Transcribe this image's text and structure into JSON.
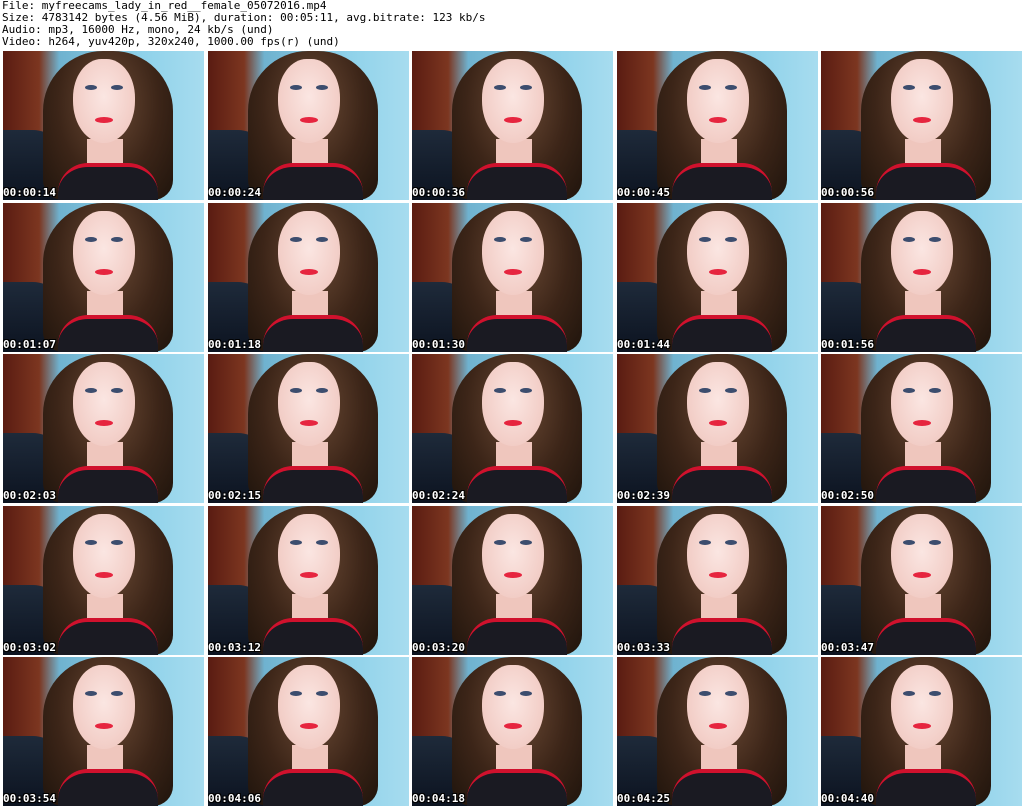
{
  "header": {
    "file": "File: myfreecams_lady_in_red__female_05072016.mp4",
    "size": "Size: 4783142 bytes (4.56 MiB), duration: 00:05:11, avg.bitrate: 123 kb/s",
    "audio": "Audio: mp3, 16000 Hz, mono, 24 kb/s (und)",
    "video": "Video: h264, yuv420p, 320x240, 1000.00 fps(r) (und)"
  },
  "thumbnails": [
    {
      "timestamp": "00:00:14"
    },
    {
      "timestamp": "00:00:24"
    },
    {
      "timestamp": "00:00:36"
    },
    {
      "timestamp": "00:00:45"
    },
    {
      "timestamp": "00:00:56"
    },
    {
      "timestamp": "00:01:07"
    },
    {
      "timestamp": "00:01:18"
    },
    {
      "timestamp": "00:01:30"
    },
    {
      "timestamp": "00:01:44"
    },
    {
      "timestamp": "00:01:56"
    },
    {
      "timestamp": "00:02:03"
    },
    {
      "timestamp": "00:02:15"
    },
    {
      "timestamp": "00:02:24"
    },
    {
      "timestamp": "00:02:39"
    },
    {
      "timestamp": "00:02:50"
    },
    {
      "timestamp": "00:03:02"
    },
    {
      "timestamp": "00:03:12"
    },
    {
      "timestamp": "00:03:20"
    },
    {
      "timestamp": "00:03:33"
    },
    {
      "timestamp": "00:03:47"
    },
    {
      "timestamp": "00:03:54"
    },
    {
      "timestamp": "00:04:06"
    },
    {
      "timestamp": "00:04:18"
    },
    {
      "timestamp": "00:04:25"
    },
    {
      "timestamp": "00:04:40"
    }
  ]
}
